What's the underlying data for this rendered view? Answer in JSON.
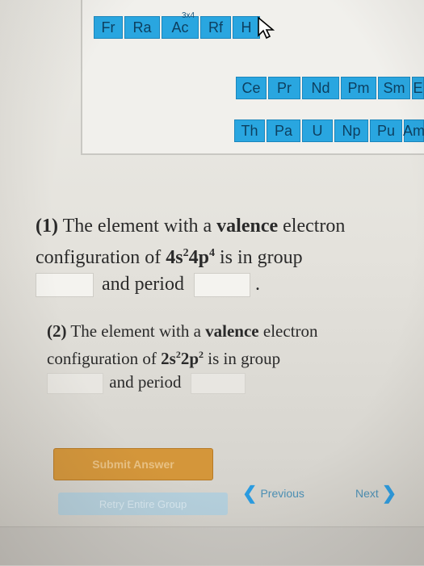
{
  "periodic_table": {
    "row7": [
      "Fr",
      "Ra",
      "Ac",
      "Rf",
      "H"
    ],
    "superscript": "3x4",
    "lanthanides": [
      "Ce",
      "Pr",
      "Nd",
      "Pm",
      "Sm",
      "E"
    ],
    "actinides": [
      "Th",
      "Pa",
      "U",
      "Np",
      "Pu",
      "Am"
    ]
  },
  "q1": {
    "number": "(1)",
    "pre": "The element with a",
    "bold": "valence",
    "post": "electron",
    "line2_pre": "configuration of",
    "config_a": "4s",
    "config_a_sup": "2",
    "config_b": "4p",
    "config_b_sup": "4",
    "line2_post": "is in group",
    "period_label": "and period",
    "end": "."
  },
  "q2": {
    "number": "(2)",
    "pre": "The element with a",
    "bold": "valence",
    "post": "electron",
    "line2_pre": "configuration of",
    "config_a": "2s",
    "config_a_sup": "2",
    "config_b": "2p",
    "config_b_sup": "2",
    "line2_post": "is in group",
    "period_label": "and period"
  },
  "buttons": {
    "submit": "Submit Answer",
    "retry": "Retry Entire Group",
    "previous": "Previous",
    "next": "Next"
  },
  "colors": {
    "element_cell": "#29a6e0",
    "submit": "#d4963a",
    "link": "#2a9be0"
  }
}
